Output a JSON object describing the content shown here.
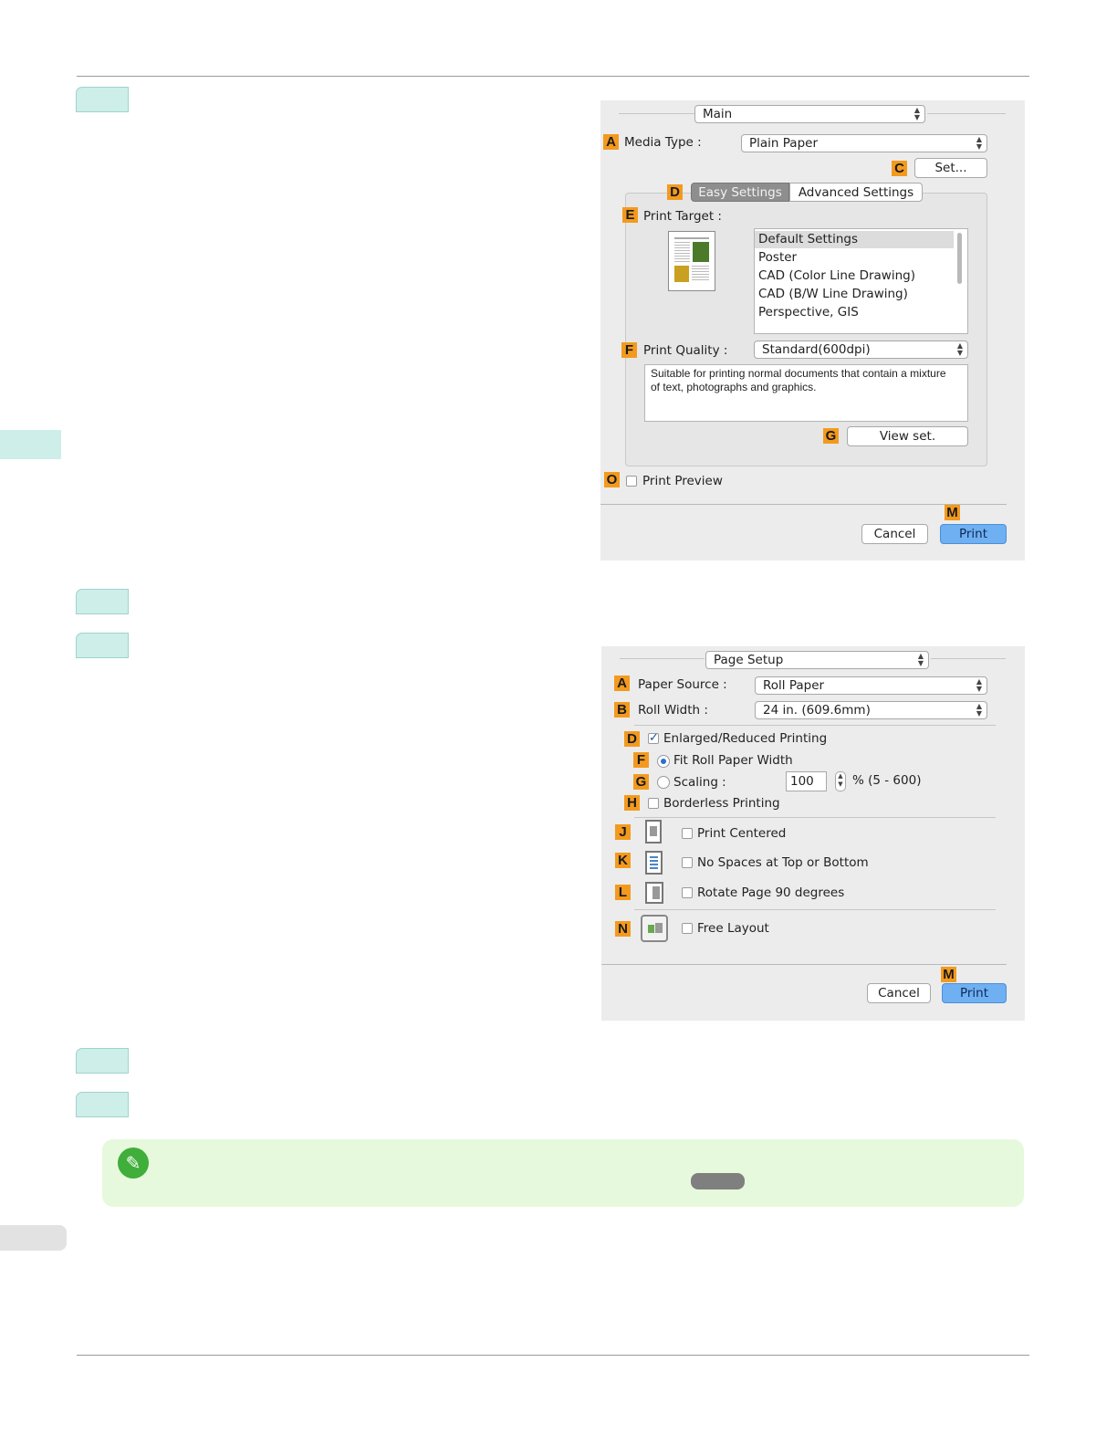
{
  "dialog1": {
    "menu": "Main",
    "badges": {
      "a": "A",
      "c": "C",
      "d": "D",
      "e": "E",
      "f": "F",
      "g": "G",
      "o": "O",
      "m": "M"
    },
    "media_type_label": "Media Type :",
    "media_type_value": "Plain Paper",
    "set_button": "Set...",
    "tab_easy": "Easy Settings",
    "tab_advanced": "Advanced Settings",
    "print_target_label": "Print Target :",
    "print_targets": [
      "Default Settings",
      "Poster",
      "CAD (Color Line Drawing)",
      "CAD (B/W Line Drawing)",
      "Perspective, GIS"
    ],
    "print_quality_label": "Print Quality :",
    "print_quality_value": "Standard(600dpi)",
    "description": "Suitable for printing normal documents that contain a mixture of text, photographs and graphics.",
    "view_set_button": "View set.",
    "print_preview_label": "Print Preview",
    "cancel_button": "Cancel",
    "print_button": "Print"
  },
  "dialog2": {
    "menu": "Page Setup",
    "badges": {
      "a": "A",
      "b": "B",
      "d": "D",
      "f": "F",
      "g": "G",
      "h": "H",
      "j": "J",
      "k": "K",
      "l": "L",
      "n": "N",
      "m": "M"
    },
    "paper_source_label": "Paper Source :",
    "paper_source_value": "Roll Paper",
    "roll_width_label": "Roll Width :",
    "roll_width_value": "24 in. (609.6mm)",
    "enlarged_label": "Enlarged/Reduced Printing",
    "fit_roll_label": "Fit Roll Paper Width",
    "scaling_label": "Scaling :",
    "scaling_value": "100",
    "scaling_range": "% (5 - 600)",
    "borderless_label": "Borderless Printing",
    "print_centered_label": "Print Centered",
    "no_spaces_label": "No Spaces at Top or Bottom",
    "rotate_label": "Rotate Page 90 degrees",
    "free_layout_label": "Free Layout",
    "cancel_button": "Cancel",
    "print_button": "Print"
  },
  "colors": {
    "badge": "#f39a1e",
    "step_tab": "#cdeee9",
    "note_bg": "#e7f9dd",
    "print_button": "#6fb0f2"
  },
  "icons": {
    "note": "pencil-note-icon"
  }
}
